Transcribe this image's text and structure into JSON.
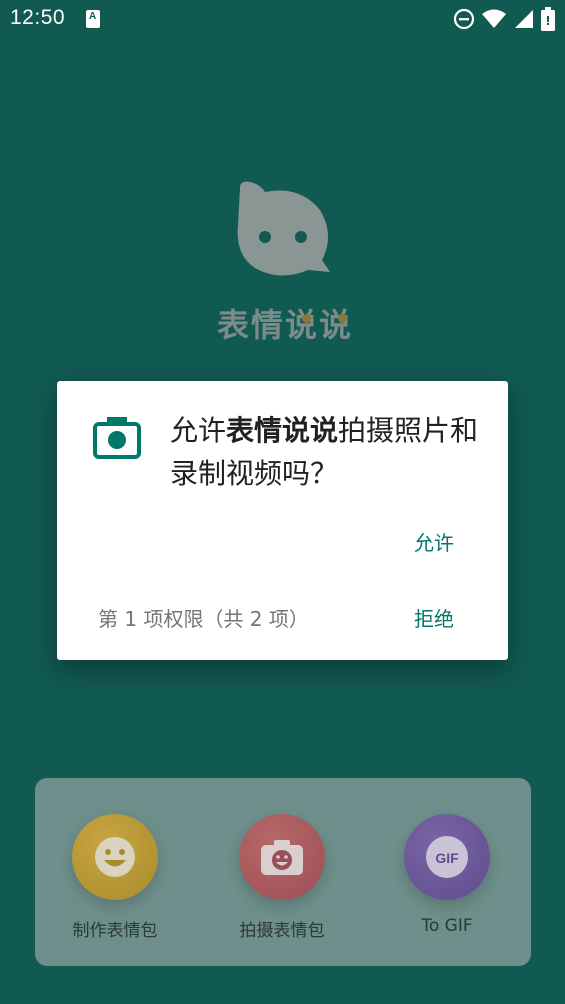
{
  "status_bar": {
    "time": "12:50",
    "notification_icon_letter": "A",
    "icons": [
      "do-not-disturb-icon",
      "wifi-icon",
      "cell-signal-icon",
      "battery-icon"
    ]
  },
  "app": {
    "name": "表情说说",
    "features": [
      {
        "label": "制作表情包",
        "icon": "smiley-icon"
      },
      {
        "label": "拍摄表情包",
        "icon": "camera-smiley-icon"
      },
      {
        "label": "To GIF",
        "icon": "gif-icon",
        "icon_text": "GIF"
      }
    ]
  },
  "dialog": {
    "message_prefix": "允许",
    "app_name": "表情说说",
    "message_suffix": "拍摄照片和录制视频吗？",
    "allow_label": "允许",
    "deny_label": "拒绝",
    "permission_count": "第 1 项权限（共 2 项）"
  },
  "colors": {
    "scrim_bg": "#115a52",
    "accent": "#00796b",
    "dialog_bg": "#ffffff"
  }
}
